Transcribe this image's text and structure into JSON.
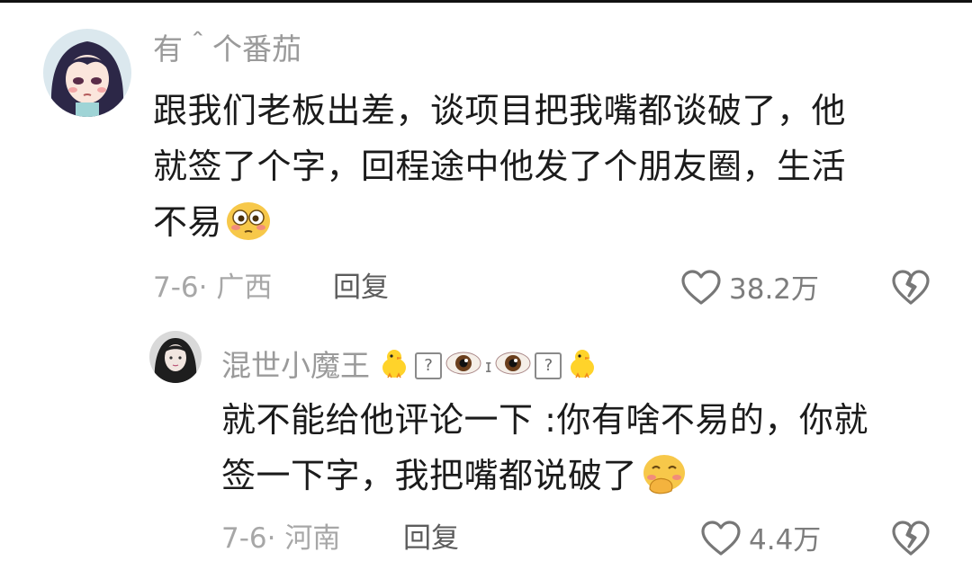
{
  "comments": [
    {
      "username": "有＾个番茄",
      "text_lines": [
        "跟我们老板出差，谈项目把我嘴都谈破了，他",
        "就签了个字，回程途中他发了个朋友圈，生活",
        "不易"
      ],
      "date_location": "7-6· 广西",
      "reply_label": "回复",
      "likes": "38.2万",
      "end_emoji": "flushed-face-emoji"
    },
    {
      "username": "混世小魔王",
      "name_decor": [
        "chick-emoji",
        "?",
        "eye-emoji",
        "ɪ",
        "eye-emoji",
        "?",
        "chick-emoji"
      ],
      "text_lines": [
        "就不能给他评论一下 :你有啥不易的，你就",
        "签一下字，我把嘴都说破了"
      ],
      "date_location": "7-6· 河南",
      "reply_label": "回复",
      "likes": "4.4万",
      "end_emoji": "face-with-hand-over-mouth-emoji"
    }
  ],
  "icons": {
    "like": "heart-outline-icon",
    "dislike": "broken-heart-outline-icon"
  },
  "colors": {
    "username": "#9a9a9a",
    "body_text": "#1b1b1b",
    "meta": "#a7a7a7",
    "reply": "#5c5c5c"
  }
}
